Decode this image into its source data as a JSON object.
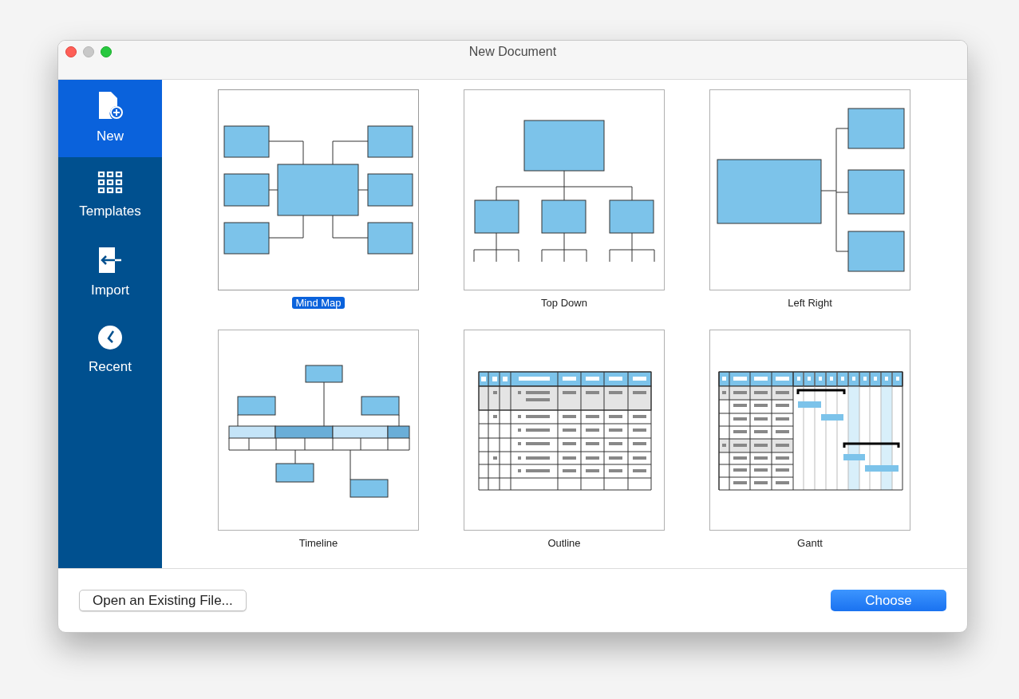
{
  "window": {
    "title": "New Document"
  },
  "sidebar": {
    "items": [
      {
        "label": "New",
        "kind": "new",
        "selected": true
      },
      {
        "label": "Templates",
        "kind": "templates",
        "selected": false
      },
      {
        "label": "Import",
        "kind": "import",
        "selected": false
      },
      {
        "label": "Recent",
        "kind": "recent",
        "selected": false
      }
    ]
  },
  "templates": [
    {
      "label": "Mind Map",
      "kind": "mindmap",
      "selected": true
    },
    {
      "label": "Top Down",
      "kind": "topdown",
      "selected": false
    },
    {
      "label": "Left Right",
      "kind": "leftright",
      "selected": false
    },
    {
      "label": "Timeline",
      "kind": "timeline",
      "selected": false
    },
    {
      "label": "Outline",
      "kind": "outline",
      "selected": false
    },
    {
      "label": "Gantt",
      "kind": "gantt",
      "selected": false
    }
  ],
  "footer": {
    "open_button": "Open an Existing File...",
    "choose_button": "Choose"
  }
}
